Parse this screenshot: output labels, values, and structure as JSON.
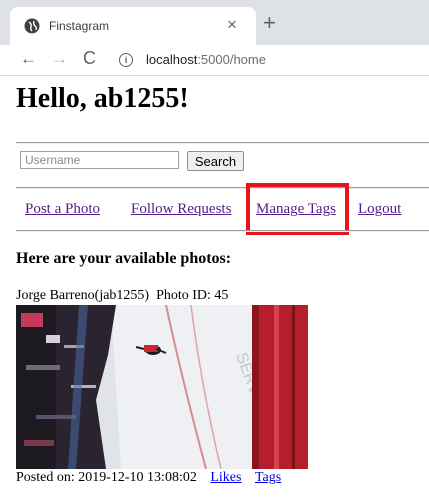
{
  "browser": {
    "tab_title": "Finstagram",
    "tab_close": "×",
    "new_tab": "+",
    "back": "←",
    "forward": "→",
    "reload": "C",
    "info": "i",
    "url_host": "localhost",
    "url_path": ":5000/home"
  },
  "page": {
    "greeting": "Hello, ab1255!",
    "search": {
      "placeholder": "Username",
      "button_label": "Search"
    },
    "nav": {
      "post_photo": "Post a Photo",
      "follow_requests": "Follow Requests",
      "manage_tags": "Manage Tags",
      "logout": "Logout"
    },
    "section_title": "Here are your available photos:",
    "photo": {
      "poster": "Jorge Barreno(jab1255)",
      "photo_id_label": "Photo ID: 45",
      "posted_on": "Posted on: 2019-12-10 13:08:02",
      "likes_label": "Likes",
      "tags_label": "Tags"
    }
  },
  "colors": {
    "visited_link": "#551a8b",
    "link": "#0000ee",
    "highlight": "#e8141c"
  }
}
